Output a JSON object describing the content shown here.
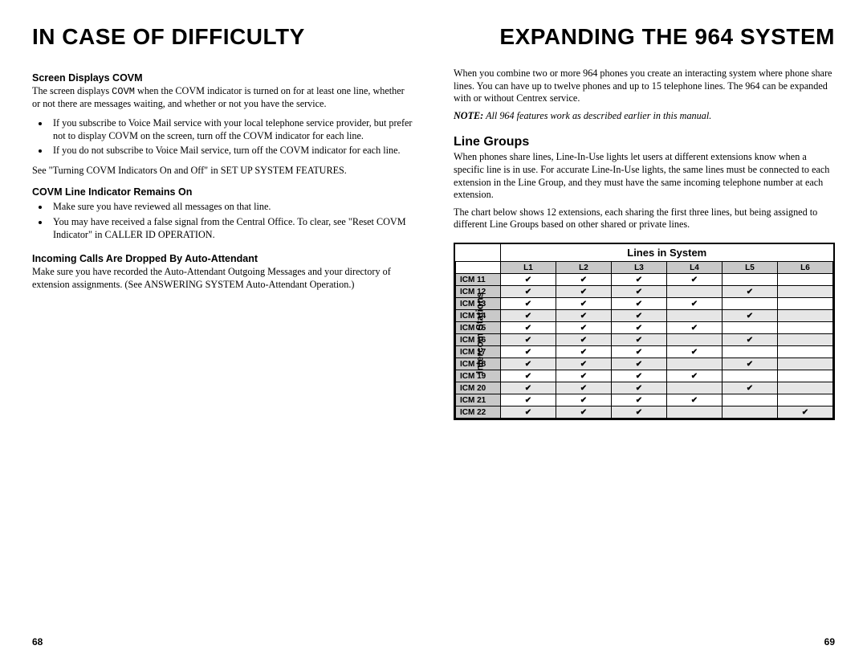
{
  "left": {
    "title": "IN CASE OF DIFFICULTY",
    "s1_head": "Screen Displays COVM",
    "s1_p1a": "The screen displays ",
    "s1_p1_code": "COVM",
    "s1_p1b": " when the COVM indicator is turned on for at least one line, whether or not there are messages waiting, and whether or not you have the service.",
    "s1_b1": "If you subscribe to Voice Mail service with your local telephone service provider, but prefer not to display COVM on the screen, turn off the COVM indicator for each line.",
    "s1_b2": "If you do not subscribe to Voice Mail service, turn off the COVM indicator for each line.",
    "s1_p2": "See \"Turning COVM Indicators On and Off\" in SET UP SYSTEM FEATURES.",
    "s2_head": "COVM Line Indicator Remains On",
    "s2_b1": "Make sure you have reviewed all messages on that line.",
    "s2_b2": "You may have received a false signal from the Central Office.  To clear, see \"Reset COVM Indicator\" in CALLER ID OPERATION.",
    "s3_head": "Incoming Calls Are Dropped By Auto-Attendant",
    "s3_p1": "Make sure you have recorded the Auto-Attendant Outgoing Messages and your directory of extension assignments.  (See ANSWERING SYSTEM Auto-Attendant Operation.)",
    "pagenum": "68"
  },
  "right": {
    "title": "EXPANDING THE 964 SYSTEM",
    "p1": "When you combine two or more 964 phones you create an interacting system where phone share lines. You can have up to twelve phones and up to 15 telephone lines. The 964 can be expanded with or without Centrex service.",
    "note_label": "NOTE:",
    "note_text": "  All 964 features work as described earlier in this manual.",
    "sec_head": "Line Groups",
    "p2": "When phones share lines, Line-In-Use lights let users at different extensions know when a specific line is in use. For accurate Line-In-Use lights, the same lines must be connected to each extension in the Line Group, and they must have the same incoming telephone number at each extension.",
    "p3": "The chart below shows 12 extensions, each sharing the first three lines, but being assigned to different Line Groups based on other shared or private lines.",
    "pagenum": "69"
  },
  "chart_data": {
    "type": "table",
    "title": "Lines in System",
    "side_label": "Intercom Stations",
    "columns": [
      "L1",
      "L2",
      "L3",
      "L4",
      "L5",
      "L6"
    ],
    "rows": [
      {
        "name": "ICM 11",
        "v": [
          1,
          1,
          1,
          1,
          0,
          0
        ]
      },
      {
        "name": "ICM 12",
        "v": [
          1,
          1,
          1,
          0,
          1,
          0
        ]
      },
      {
        "name": "ICM 13",
        "v": [
          1,
          1,
          1,
          1,
          0,
          0
        ]
      },
      {
        "name": "ICM 14",
        "v": [
          1,
          1,
          1,
          0,
          1,
          0
        ]
      },
      {
        "name": "ICM 15",
        "v": [
          1,
          1,
          1,
          1,
          0,
          0
        ]
      },
      {
        "name": "ICM 16",
        "v": [
          1,
          1,
          1,
          0,
          1,
          0
        ]
      },
      {
        "name": "ICM 17",
        "v": [
          1,
          1,
          1,
          1,
          0,
          0
        ]
      },
      {
        "name": "ICM 18",
        "v": [
          1,
          1,
          1,
          0,
          1,
          0
        ]
      },
      {
        "name": "ICM 19",
        "v": [
          1,
          1,
          1,
          1,
          0,
          0
        ]
      },
      {
        "name": "ICM 20",
        "v": [
          1,
          1,
          1,
          0,
          1,
          0
        ]
      },
      {
        "name": "ICM 21",
        "v": [
          1,
          1,
          1,
          1,
          0,
          0
        ]
      },
      {
        "name": "ICM 22",
        "v": [
          1,
          1,
          1,
          0,
          0,
          1
        ]
      }
    ]
  }
}
